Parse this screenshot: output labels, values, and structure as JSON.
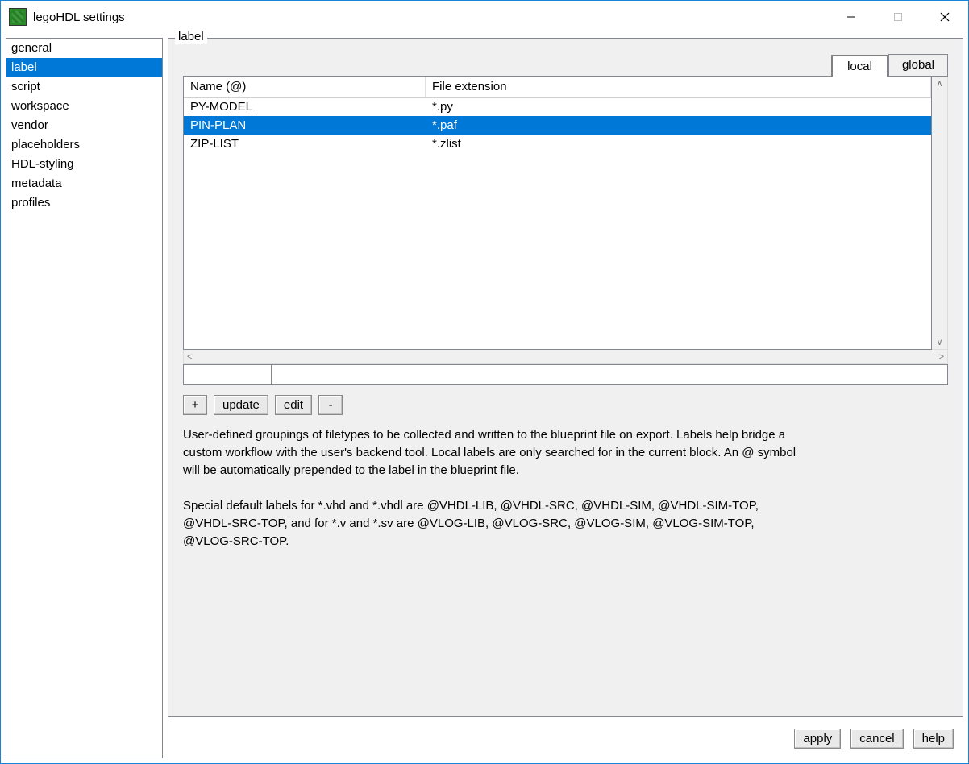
{
  "window": {
    "title": "legoHDL settings"
  },
  "sidebar": {
    "items": [
      {
        "label": "general"
      },
      {
        "label": "label",
        "selected": true
      },
      {
        "label": "script"
      },
      {
        "label": "workspace"
      },
      {
        "label": "vendor"
      },
      {
        "label": "placeholders"
      },
      {
        "label": "HDL-styling"
      },
      {
        "label": "metadata"
      },
      {
        "label": "profiles"
      }
    ]
  },
  "panel": {
    "header": "label",
    "tabs": {
      "local": "local",
      "global": "global",
      "active": "local"
    },
    "table": {
      "headers": {
        "name": "Name (@)",
        "ext": "File extension"
      },
      "rows": [
        {
          "name": "PY-MODEL",
          "ext": "*.py",
          "selected": false
        },
        {
          "name": "PIN-PLAN",
          "ext": "*.paf",
          "selected": true
        },
        {
          "name": "ZIP-LIST",
          "ext": "*.zlist",
          "selected": false
        }
      ]
    },
    "inputs": {
      "name_value": "",
      "ext_value": ""
    },
    "buttons": {
      "add": "+",
      "update": "update",
      "edit": "edit",
      "remove": "-"
    },
    "description": {
      "p1": "User-defined groupings of filetypes to be collected and written to the blueprint file on export. Labels help bridge a custom workflow with the user's backend tool. Local labels are only searched for in the current block. An @ symbol will be automatically prepended to the label in the blueprint file.",
      "p2": "Special default labels for *.vhd and *.vhdl are @VHDL-LIB, @VHDL-SRC, @VHDL-SIM, @VHDL-SIM-TOP, @VHDL-SRC-TOP, and for *.v and *.sv are @VLOG-LIB, @VLOG-SRC, @VLOG-SIM, @VLOG-SIM-TOP, @VLOG-SRC-TOP."
    }
  },
  "footer": {
    "apply": "apply",
    "cancel": "cancel",
    "help": "help"
  }
}
